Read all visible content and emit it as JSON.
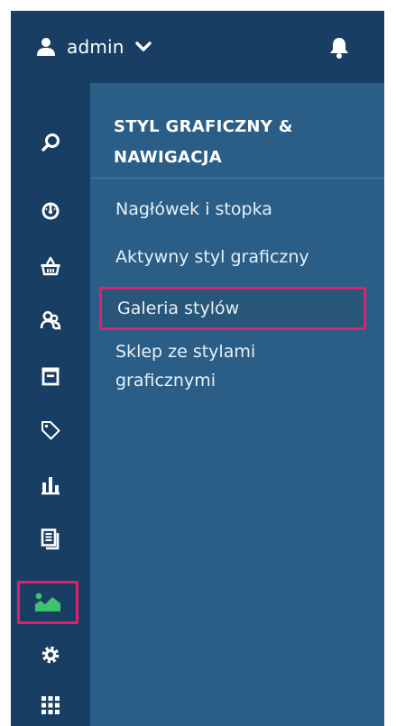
{
  "header": {
    "username": "admin",
    "user_icon": "user-icon",
    "dropdown_icon": "chevron-down-icon",
    "notifications_icon": "bell-icon"
  },
  "rail": {
    "items": [
      {
        "name": "search",
        "icon": "search-icon"
      },
      {
        "name": "dashboard",
        "icon": "speedometer-icon"
      },
      {
        "name": "orders",
        "icon": "basket-icon"
      },
      {
        "name": "customers",
        "icon": "users-icon"
      },
      {
        "name": "products",
        "icon": "box-icon"
      },
      {
        "name": "promotions",
        "icon": "tag-icon"
      },
      {
        "name": "reports",
        "icon": "bar-chart-icon"
      },
      {
        "name": "content",
        "icon": "documents-icon"
      },
      {
        "name": "appearance",
        "icon": "image-icon",
        "active": true
      },
      {
        "name": "settings",
        "icon": "gear-icon"
      },
      {
        "name": "apps",
        "icon": "grid-icon"
      }
    ]
  },
  "panel": {
    "title": "STYL GRAFICZNY & NAWIGACJA",
    "links": [
      {
        "label": "Nagłówek i stopka"
      },
      {
        "label": "Aktywny styl graficzny"
      },
      {
        "label": "Galeria stylów",
        "selected": true
      },
      {
        "label": "Sklep ze stylami graficznymi"
      }
    ]
  },
  "colors": {
    "sidebar": "#183f63",
    "panel": "#2b5e86",
    "highlight": "#e0206e",
    "active_icon": "#3ec26b"
  }
}
